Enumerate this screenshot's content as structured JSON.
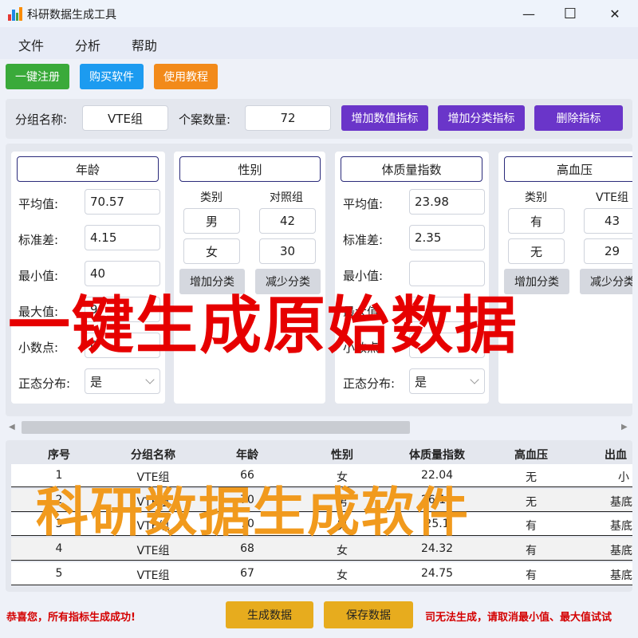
{
  "window": {
    "title": "科研数据生成工具",
    "controls": {
      "minimize": "—",
      "maximize": "☐",
      "close": "✕"
    }
  },
  "menu": [
    "文件",
    "分析",
    "帮助"
  ],
  "toolbar": {
    "register": "一键注册",
    "buy": "购买软件",
    "tutorial": "使用教程"
  },
  "group": {
    "name_label": "分组名称:",
    "name_value": "VTE组",
    "count_label": "个案数量:",
    "count_value": "72",
    "add_numeric": "增加数值指标",
    "add_category": "增加分类指标",
    "delete": "删除指标"
  },
  "numeric_labels": {
    "mean": "平均值:",
    "sd": "标准差:",
    "min": "最小值:",
    "max": "最大值:",
    "decimals": "小数点:",
    "normal": "正态分布:"
  },
  "cards": {
    "age": {
      "title": "年龄",
      "mean": "70.57",
      "sd": "4.15",
      "min": "40",
      "max": "9",
      "decimals": "0",
      "normal": "是"
    },
    "sex": {
      "title": "性别",
      "col1": "类别",
      "col2": "对照组",
      "rows": [
        [
          "男",
          "42"
        ],
        [
          "女",
          "30"
        ]
      ],
      "add": "增加分类",
      "remove": "减少分类"
    },
    "bmi": {
      "title": "体质量指数",
      "mean": "23.98",
      "sd": "2.35",
      "min": "",
      "max": "",
      "decimals": "",
      "normal": "是"
    },
    "hypertension": {
      "title": "高血压",
      "col1": "类别",
      "col2": "VTE组",
      "rows": [
        [
          "有",
          "43"
        ],
        [
          "无",
          "29"
        ]
      ],
      "add": "增加分类",
      "remove": "减少分类"
    }
  },
  "scrollbar": {
    "left": "◀",
    "right": "▶"
  },
  "table": {
    "headers": [
      "序号",
      "分组名称",
      "年龄",
      "性别",
      "体质量指数",
      "高血压",
      "出血"
    ],
    "rows": [
      [
        "1",
        "VTE组",
        "66",
        "女",
        "22.04",
        "无",
        "小"
      ],
      [
        "2",
        "VTE组",
        "70",
        "男",
        "26.11",
        "无",
        "基底"
      ],
      [
        "3",
        "VTE组",
        "70",
        "男",
        "25.1",
        "有",
        "基底"
      ],
      [
        "4",
        "VTE组",
        "68",
        "女",
        "24.32",
        "有",
        "基底"
      ],
      [
        "5",
        "VTE组",
        "67",
        "女",
        "24.75",
        "有",
        "基底"
      ]
    ]
  },
  "overlays": {
    "banner1": "一键生成原始数据",
    "banner2": "科研数据生成软件"
  },
  "footer": {
    "success": "恭喜您，所有指标生成成功!",
    "generate": "生成数据",
    "save": "保存数据",
    "hint": "司无法生成，请取消最小值、最大值试试"
  },
  "colors": {
    "green": "#3aaa3a",
    "blue": "#1c9bf0",
    "orange": "#f28a1a",
    "purple": "#6a35c9",
    "yellow": "#e7ac1e",
    "red": "#e60000",
    "overlay_orange": "#f19a1d"
  }
}
